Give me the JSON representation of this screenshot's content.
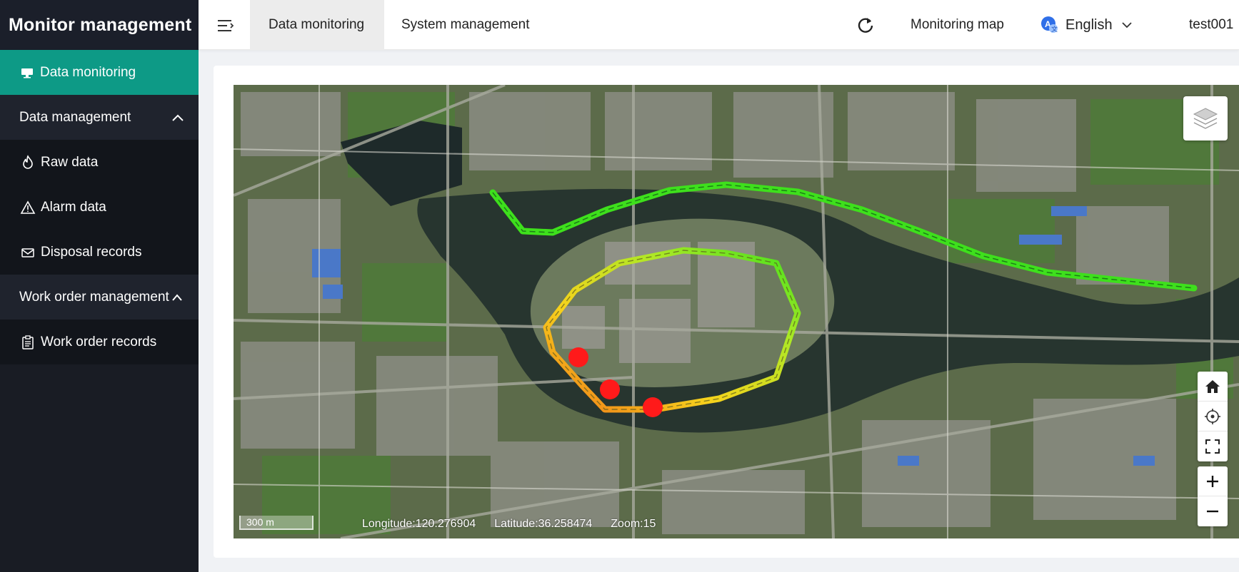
{
  "app": {
    "title": "Monitor management"
  },
  "sidebar": {
    "items": [
      {
        "label": "Data monitoring",
        "icon": "monitor-icon",
        "active": true
      },
      {
        "label": "Data management",
        "icon": "chevron-up-icon",
        "group": true
      },
      {
        "label": "Raw data",
        "icon": "flame-icon"
      },
      {
        "label": "Alarm data",
        "icon": "warning-icon"
      },
      {
        "label": "Disposal records",
        "icon": "mail-icon"
      },
      {
        "label": "Work order management",
        "icon": "chevron-up-icon",
        "group": true
      },
      {
        "label": "Work order records",
        "icon": "clipboard-icon"
      }
    ]
  },
  "header": {
    "tabs": [
      {
        "label": "Data monitoring",
        "active": true
      },
      {
        "label": "System management",
        "active": false
      }
    ],
    "monitoring_map": "Monitoring map",
    "language": "English",
    "user": "test001"
  },
  "map": {
    "scale": "300 m",
    "longitude": "Longitude:120.276904",
    "latitude": "Latitude:36.258474",
    "zoom": "Zoom:15",
    "colors": {
      "route_green": "#3ee01c",
      "route_yellow": "#d8ef20",
      "route_orange": "#f29a1c",
      "alarm_red": "#ff1a1a",
      "accent": "#0d9a86"
    }
  }
}
